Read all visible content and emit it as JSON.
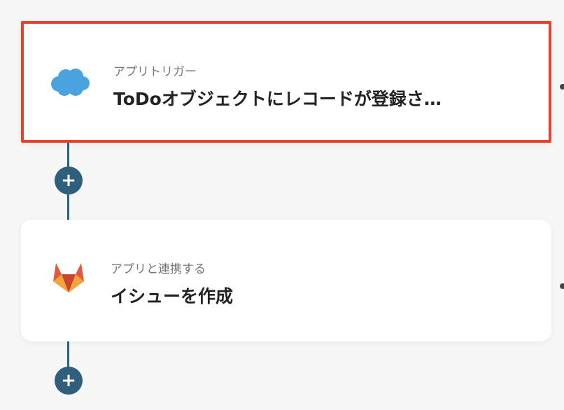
{
  "steps": [
    {
      "app": "salesforce",
      "label": "アプリトリガー",
      "title": "ToDoオブジェクトにレコードが登録さ…",
      "selected": true
    },
    {
      "app": "gitlab",
      "label": "アプリと連携する",
      "title": "イシューを作成",
      "selected": false
    }
  ],
  "add_button": {
    "symbol": "+"
  },
  "colors": {
    "connector": "#2e5f7d",
    "selection_border": "#e5432c",
    "salesforce_blue": "#4aa3df",
    "gitlab_orange": "#e2583e"
  },
  "icons": [
    "salesforce-cloud-icon",
    "gitlab-tanuki-icon",
    "plus-icon"
  ]
}
